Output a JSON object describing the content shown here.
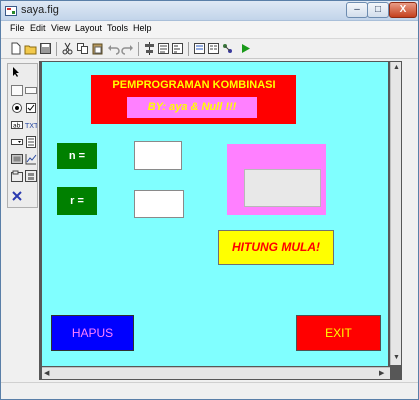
{
  "window": {
    "title": "saya.fig",
    "controls": {
      "minimize": "–",
      "maximize": "□",
      "close": "X"
    }
  },
  "menu": [
    "File",
    "Edit",
    "View",
    "Layout",
    "Tools",
    "Help"
  ],
  "toolbar_icons": [
    "new-file-icon",
    "open-folder-icon",
    "save-icon",
    "cut-icon",
    "copy-icon",
    "paste-icon",
    "undo-icon",
    "redo-icon",
    "align-objects-icon",
    "menu-editor-icon",
    "tab-order-icon",
    "mfile-editor-icon",
    "property-inspector-icon",
    "object-browser-icon",
    "run-icon"
  ],
  "palette_icons": [
    "select-arrow-icon",
    "push-button-icon",
    "slider-icon",
    "radio-button-icon",
    "checkbox-icon",
    "edit-text-icon",
    "static-text-icon",
    "popup-menu-icon",
    "listbox-icon",
    "toggle-button-icon",
    "axes-icon",
    "panel-icon",
    "button-group-icon",
    "activex-icon"
  ],
  "figure": {
    "title": "PEMPROGRAMAN KOMBINASI",
    "subtitle": "BY: aya & Null !!!",
    "label_n": "n =",
    "label_r": "r =",
    "input_n_value": "",
    "input_r_value": "",
    "result_value": "",
    "button_hitung": "HITUNG MULA!",
    "button_hapus": "HAPUS",
    "button_exit": "EXIT"
  },
  "colors": {
    "canvas": "#80ffff",
    "title_panel": "#ff0000",
    "title_text": "#ffff00",
    "subtitle_box": "#ff80ff",
    "label_bg": "#008000",
    "hitung_bg": "#ffff00",
    "hitung_text": "#ff0000",
    "hapus_bg": "#0000ff",
    "hapus_text": "#ff80ff",
    "exit_bg": "#ff0000",
    "exit_text": "#ffff00"
  }
}
